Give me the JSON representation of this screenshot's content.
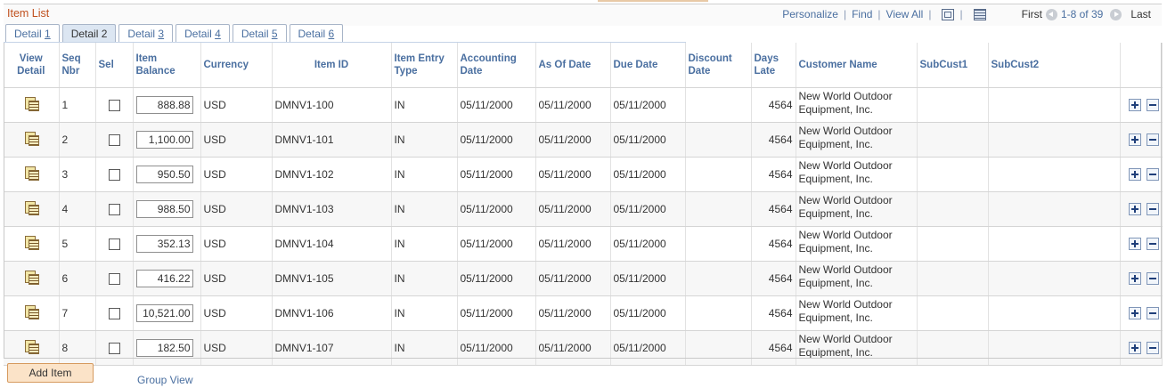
{
  "grid": {
    "title": "Item List",
    "nav": {
      "personalize": "Personalize",
      "find": "Find",
      "view_all": "View All",
      "first": "First",
      "counter": "1-8 of 39",
      "last": "Last",
      "zoom_icon": "zoom-grid-icon",
      "download_icon": "download-excel-icon"
    }
  },
  "tabs": [
    {
      "label_pre": "Detail ",
      "label_u": "1",
      "active": false
    },
    {
      "label_pre": "Detail ",
      "label_u": "2",
      "active": true
    },
    {
      "label_pre": "Detail ",
      "label_u": "3",
      "active": false
    },
    {
      "label_pre": "Detail ",
      "label_u": "4",
      "active": false
    },
    {
      "label_pre": "Detail ",
      "label_u": "5",
      "active": false
    },
    {
      "label_pre": "Detail ",
      "label_u": "6",
      "active": false
    }
  ],
  "columns": {
    "view_detail_1": "View",
    "view_detail_2": "Detail",
    "seq_1": "Seq",
    "seq_2": "Nbr",
    "sel": "Sel",
    "item_balance_1": "Item",
    "item_balance_2": "Balance",
    "currency": "Currency",
    "item_id": "Item ID",
    "item_entry_1": "Item Entry",
    "item_entry_2": "Type",
    "acct_date_1": "Accounting",
    "acct_date_2": "Date",
    "as_of_date": "As Of Date",
    "due_date": "Due Date",
    "disc_date_1": "Discount",
    "disc_date_2": "Date",
    "days_late_1": "Days",
    "days_late_2": "Late",
    "customer_name": "Customer Name",
    "subcust1": "SubCust1",
    "subcust2": "SubCust2"
  },
  "rows": [
    {
      "seq": "1",
      "balance": "888.88",
      "currency": "USD",
      "item_id": "DMNV1-100",
      "entry_type": "IN",
      "acct_date": "05/11/2000",
      "as_of": "05/11/2000",
      "due": "05/11/2000",
      "discount": "",
      "days_late": "4564",
      "customer": "New World Outdoor Equipment, Inc.",
      "subcust1": "",
      "subcust2": ""
    },
    {
      "seq": "2",
      "balance": "1,100.00",
      "currency": "USD",
      "item_id": "DMNV1-101",
      "entry_type": "IN",
      "acct_date": "05/11/2000",
      "as_of": "05/11/2000",
      "due": "05/11/2000",
      "discount": "",
      "days_late": "4564",
      "customer": "New World Outdoor Equipment, Inc.",
      "subcust1": "",
      "subcust2": ""
    },
    {
      "seq": "3",
      "balance": "950.50",
      "currency": "USD",
      "item_id": "DMNV1-102",
      "entry_type": "IN",
      "acct_date": "05/11/2000",
      "as_of": "05/11/2000",
      "due": "05/11/2000",
      "discount": "",
      "days_late": "4564",
      "customer": "New World Outdoor Equipment, Inc.",
      "subcust1": "",
      "subcust2": ""
    },
    {
      "seq": "4",
      "balance": "988.50",
      "currency": "USD",
      "item_id": "DMNV1-103",
      "entry_type": "IN",
      "acct_date": "05/11/2000",
      "as_of": "05/11/2000",
      "due": "05/11/2000",
      "discount": "",
      "days_late": "4564",
      "customer": "New World Outdoor Equipment, Inc.",
      "subcust1": "",
      "subcust2": ""
    },
    {
      "seq": "5",
      "balance": "352.13",
      "currency": "USD",
      "item_id": "DMNV1-104",
      "entry_type": "IN",
      "acct_date": "05/11/2000",
      "as_of": "05/11/2000",
      "due": "05/11/2000",
      "discount": "",
      "days_late": "4564",
      "customer": "New World Outdoor Equipment, Inc.",
      "subcust1": "",
      "subcust2": ""
    },
    {
      "seq": "6",
      "balance": "416.22",
      "currency": "USD",
      "item_id": "DMNV1-105",
      "entry_type": "IN",
      "acct_date": "05/11/2000",
      "as_of": "05/11/2000",
      "due": "05/11/2000",
      "discount": "",
      "days_late": "4564",
      "customer": "New World Outdoor Equipment, Inc.",
      "subcust1": "",
      "subcust2": ""
    },
    {
      "seq": "7",
      "balance": "10,521.00",
      "currency": "USD",
      "item_id": "DMNV1-106",
      "entry_type": "IN",
      "acct_date": "05/11/2000",
      "as_of": "05/11/2000",
      "due": "05/11/2000",
      "discount": "",
      "days_late": "4564",
      "customer": "New World Outdoor Equipment, Inc.",
      "subcust1": "",
      "subcust2": ""
    },
    {
      "seq": "8",
      "balance": "182.50",
      "currency": "USD",
      "item_id": "DMNV1-107",
      "entry_type": "IN",
      "acct_date": "05/11/2000",
      "as_of": "05/11/2000",
      "due": "05/11/2000",
      "discount": "",
      "days_late": "4564",
      "customer": "New World Outdoor Equipment, Inc.",
      "subcust1": "",
      "subcust2": ""
    }
  ],
  "row_icons": {
    "view_detail": "view-detail-icon",
    "add_row": "add-row-icon",
    "delete_row": "delete-row-icon"
  },
  "footer": {
    "add_item": "Add Item",
    "group_view": "Group View"
  },
  "colors": {
    "title": "#c0511f",
    "link": "#4a6fa0",
    "active_tab": "#dce6f2",
    "add_button": "#fbe3c8"
  }
}
